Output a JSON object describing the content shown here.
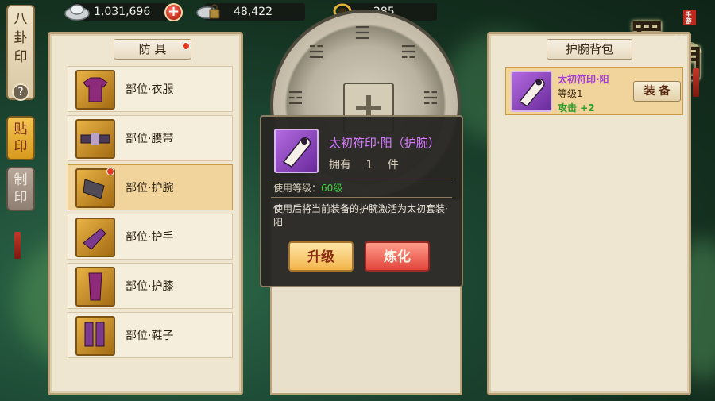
{
  "resources": {
    "silver": "1,031,696",
    "locked_silver": "48,422",
    "coupon": "285"
  },
  "side_tabs": {
    "main": "八\n卦\n印",
    "help": "?",
    "active": "贴\n印",
    "craft": "制\n印"
  },
  "left_panel": {
    "title": "防 具",
    "slots": [
      {
        "label": "部位·衣服"
      },
      {
        "label": "部位·腰带"
      },
      {
        "label": "部位·护腕"
      },
      {
        "label": "部位·护手"
      },
      {
        "label": "部位·护膝"
      },
      {
        "label": "部位·鞋子"
      }
    ]
  },
  "tooltip": {
    "name": "太初符印·阳（护腕）",
    "own_prefix": "拥有",
    "own_count": "1",
    "own_suffix": "件",
    "level_label": "使用等级：",
    "level_value": "60级",
    "description": "使用后将当前装备的护腕激活为太初套装·阳",
    "upgrade_label": "升级",
    "smelt_label": "炼化"
  },
  "right_panel": {
    "title": "护腕背包",
    "item": {
      "name": "太初符印·阳",
      "level": "等级1",
      "attack": "攻击 +2",
      "equip_label": "装 备"
    }
  },
  "logo": {
    "main1": "蜀",
    "main2": "門",
    "sub": "手游"
  },
  "close_glyph": "×",
  "colors": {
    "accent_purple": "#d47bff",
    "level_green": "#3ed144",
    "upgrade_gold": "#f2b54a",
    "smelt_red": "#e2453a"
  }
}
